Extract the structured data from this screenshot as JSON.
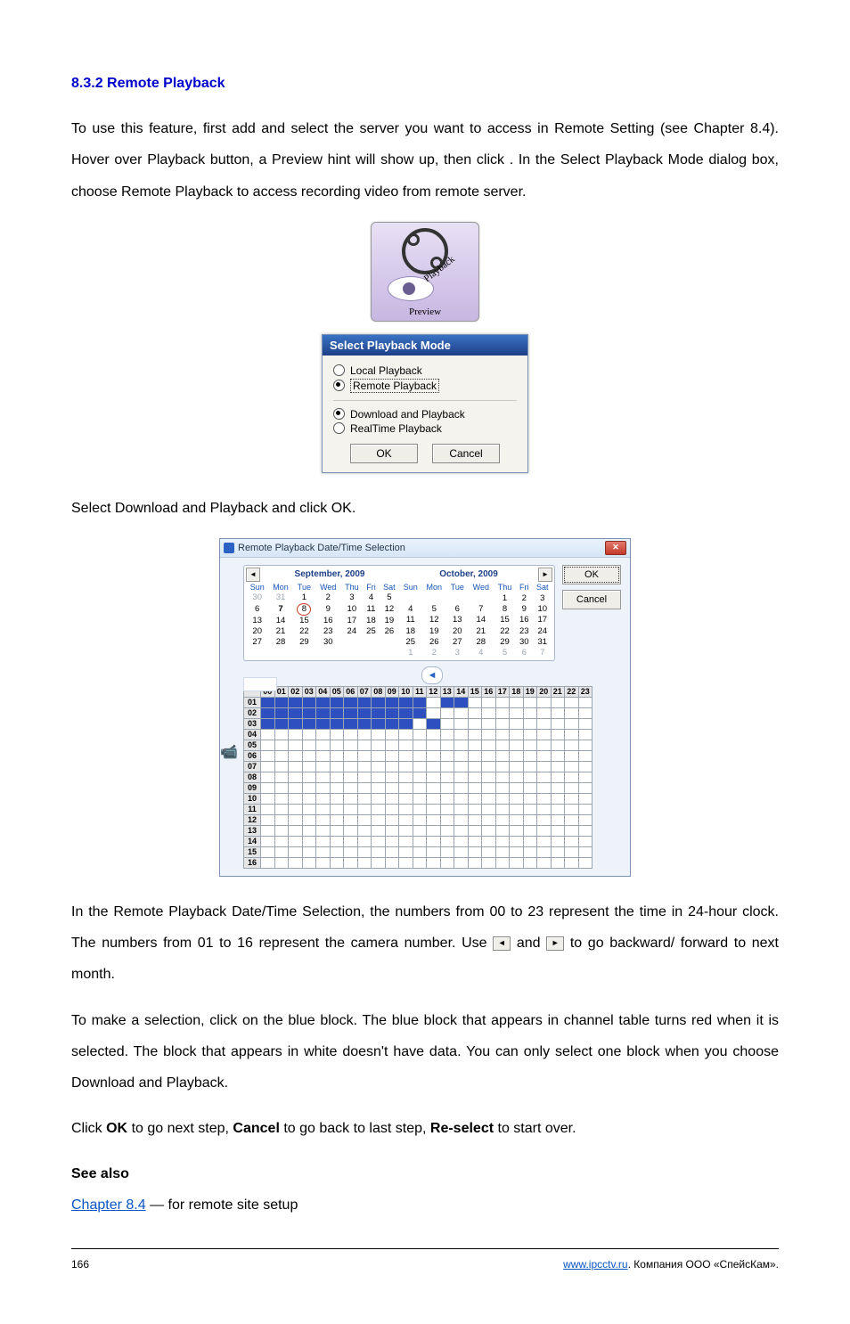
{
  "section": {
    "number": "8.3.2",
    "title": "Remote Playback"
  },
  "intro": "To use this feature, first add and select the server you want to access in Remote Setting (see Chapter 8.4). Hover over Playback button, a Preview hint will show up, then click ",
  "after_intro": ". In the Select Playback Mode dialog box, choose Remote Playback to access recording video from remote server.",
  "hover_icon": {
    "film_label": "Playback",
    "preview_label": "Preview"
  },
  "spm": {
    "title": "Select Playback Mode",
    "opts": {
      "local": "Local Playback",
      "remote": "Remote Playback",
      "download": "Download and Playback",
      "realtime": "RealTime Playback"
    },
    "ok": "OK",
    "cancel": "Cancel"
  },
  "spm_after": "Select Download and Playback and click OK.",
  "rp": {
    "title": "Remote Playback Date/Time Selection",
    "month_left": "September, 2009",
    "month_right": "October, 2009",
    "dow": [
      "Sun",
      "Mon",
      "Tue",
      "Wed",
      "Thu",
      "Fri",
      "Sat"
    ],
    "left_weeks": [
      [
        "30",
        "31",
        "1",
        "2",
        "3",
        "4",
        "5"
      ],
      [
        "6",
        "7",
        "8",
        "9",
        "10",
        "11",
        "12"
      ],
      [
        "13",
        "14",
        "15",
        "16",
        "17",
        "18",
        "19"
      ],
      [
        "20",
        "21",
        "22",
        "23",
        "24",
        "25",
        "26"
      ],
      [
        "27",
        "28",
        "29",
        "30",
        "",
        "",
        ""
      ],
      [
        "",
        "",
        "",
        "",
        "",
        "",
        ""
      ]
    ],
    "right_weeks": [
      [
        "",
        "",
        "",
        "",
        "1",
        "2",
        "3"
      ],
      [
        "4",
        "5",
        "6",
        "7",
        "8",
        "9",
        "10"
      ],
      [
        "11",
        "12",
        "13",
        "14",
        "15",
        "16",
        "17"
      ],
      [
        "18",
        "19",
        "20",
        "21",
        "22",
        "23",
        "24"
      ],
      [
        "25",
        "26",
        "27",
        "28",
        "29",
        "30",
        "31"
      ],
      [
        "1",
        "2",
        "3",
        "4",
        "5",
        "6",
        "7"
      ]
    ],
    "hours": [
      "00",
      "01",
      "02",
      "03",
      "04",
      "05",
      "06",
      "07",
      "08",
      "09",
      "10",
      "11",
      "12",
      "13",
      "14",
      "15",
      "16",
      "17",
      "18",
      "19",
      "20",
      "21",
      "22",
      "23"
    ],
    "rows": [
      "01",
      "02",
      "03",
      "04",
      "05",
      "06",
      "07",
      "08",
      "09",
      "10",
      "11",
      "12",
      "13",
      "14",
      "15",
      "16"
    ],
    "blue_map": {
      "01": [
        0,
        1,
        2,
        3,
        4,
        5,
        6,
        7,
        8,
        9,
        10,
        11,
        13,
        14
      ],
      "02": [
        0,
        1,
        2,
        3,
        4,
        5,
        6,
        7,
        8,
        9,
        10,
        11
      ],
      "03": [
        0,
        1,
        2,
        3,
        4,
        5,
        6,
        7,
        8,
        9,
        10,
        12
      ]
    },
    "ok": "OK",
    "cancel": "Cancel"
  },
  "rp_after_1": "In the Remote Playback Date/Time Selection, the numbers from 00 to 23 represent the time in 24-hour clock. The numbers from 01 to 16 represent the camera number. Use ",
  "rp_after_2": " and ",
  "rp_after_3": " to go backward/ forward to next month.",
  "para2": "To make a selection, click on the blue block. The blue block that appears in channel table turns red when it is selected. The block that appears in white doesn't have data. You can only select one block when you choose Download and Playback.",
  "para3_1": "Click ",
  "para3_2": " to go next step, ",
  "para3_3": " to go back to last step, ",
  "para3_4": " to start over.",
  "para3_ok": "OK",
  "para3_cancel": "Cancel",
  "para3_reselect": "Re-select",
  "see_also_heading": "See also",
  "see_also_text_before": "",
  "see_also_link": "Chapter 8.4",
  "see_also_text_after": " — for remote site setup",
  "footer": {
    "page": "166",
    "link_text": "www.ipcctv.ru",
    "company": ". Компания OOO «СпейсКам»."
  }
}
